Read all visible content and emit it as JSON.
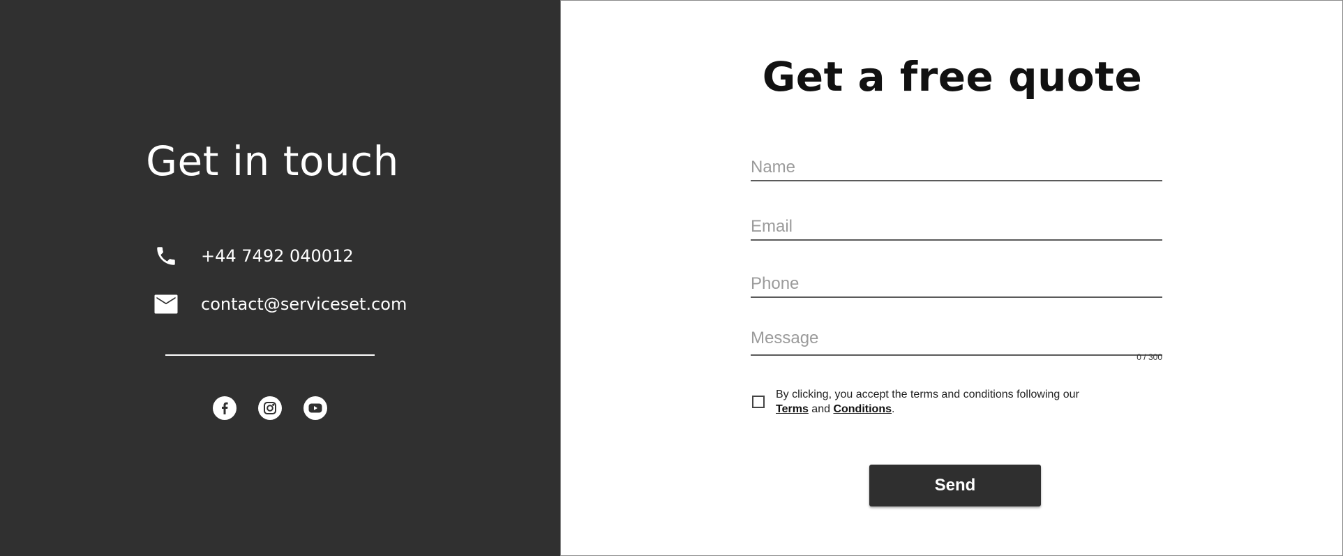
{
  "colors": {
    "panel_bg": "#303030",
    "button_bg": "#2f2f2f",
    "text_light": "#ffffff",
    "placeholder": "#9b9b9b"
  },
  "contact": {
    "title": "Get in touch",
    "phone": {
      "icon": "phone-icon",
      "text": "+44 7492 040012"
    },
    "email": {
      "icon": "mail-icon",
      "text": "contact@serviceset.com"
    },
    "socials": [
      {
        "name": "facebook-icon",
        "glyph": "f"
      },
      {
        "name": "instagram-icon"
      },
      {
        "name": "youtube-icon"
      }
    ]
  },
  "form": {
    "title": "Get a free quote",
    "name_placeholder": "Name",
    "email_placeholder": "Email",
    "phone_placeholder": "Phone",
    "message_placeholder": "Message",
    "name_value": "",
    "email_value": "",
    "phone_value": "",
    "message_value": "",
    "message_counter": "0 / 300",
    "terms": {
      "checked": false,
      "text": "By clicking, you accept the terms and conditions following our",
      "terms_link": "Terms",
      "and": "and",
      "conditions_link": "Conditions",
      "end": "."
    },
    "send_label": "Send"
  }
}
